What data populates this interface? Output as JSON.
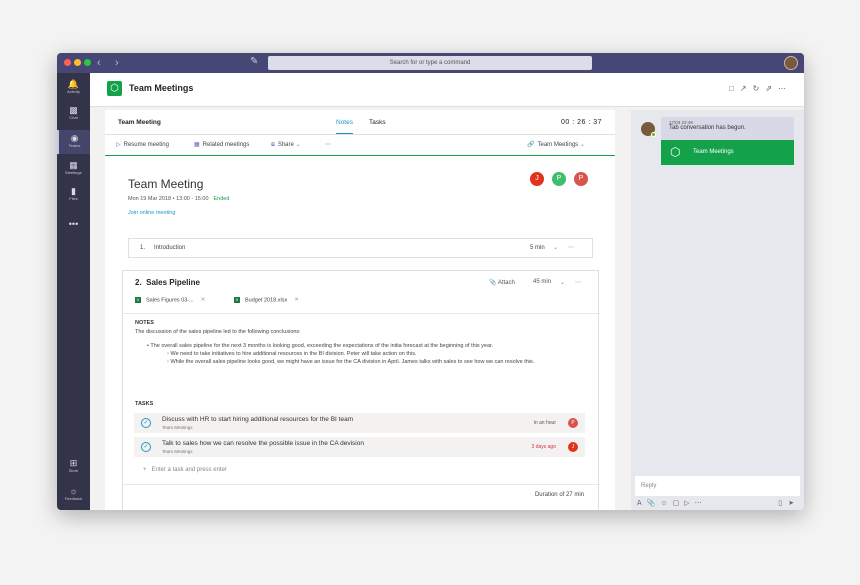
{
  "window": {
    "search_placeholder": "Search for or type a command",
    "colors": {
      "titlebar": "#464775",
      "rail": "#33344a",
      "accent_green": "#13a24a",
      "link_blue": "#2196c4"
    }
  },
  "rail": {
    "items": [
      {
        "label": "Activity",
        "icon": "bell-icon"
      },
      {
        "label": "Chat",
        "icon": "chat-icon"
      },
      {
        "label": "Teams",
        "icon": "teams-icon"
      },
      {
        "label": "Meetings",
        "icon": "calendar-icon"
      },
      {
        "label": "Files",
        "icon": "file-icon"
      },
      {
        "label": "•••",
        "icon": "more-icon"
      }
    ],
    "bottom": [
      {
        "label": "Store",
        "icon": "store-icon"
      },
      {
        "label": "Feedback",
        "icon": "feedback-icon"
      }
    ]
  },
  "app": {
    "title": "Team Meetings"
  },
  "meeting": {
    "header_title": "Team Meeting",
    "tabs": [
      "Notes",
      "Tasks"
    ],
    "timer": "00 : 26 : 37",
    "toolbar": {
      "resume": "Resume meeting",
      "related": "Related meetings",
      "share": "Share",
      "team": "Team Meetings"
    },
    "title": "Team Meeting",
    "date": "Mon 19 Mar 2018 • 13:00 - 15:00",
    "status": "Ended",
    "join": "Join online meeting",
    "attendees": [
      {
        "initial": "J",
        "color": "#e2331d"
      },
      {
        "initial": "P",
        "color": "#3fbf6e"
      },
      {
        "initial": "P",
        "color": "#d9534f"
      }
    ],
    "agenda1": {
      "num": "1.",
      "title": "Introduction",
      "duration": "5 min"
    },
    "agenda2": {
      "num": "2.",
      "title": "Sales Pipeline",
      "attach": "Attach",
      "duration": "45 min",
      "files": [
        "Sales Figures 03-...",
        "Budget 2018.xlsx"
      ],
      "notes_label": "NOTES",
      "notes_intro": "The discussion of the sales pipeline led to the following conclusions:",
      "bullets": [
        "The overall sales pipeline for the next 3 months is looking good, exceeding the expectations of the initia forecast at the beginning of this year.",
        "We need to take initiatives to hire additional resources in the BI division. Peter will take action on this.",
        "While the overall sales pipeline looks good, we might have an issue for the CA division in April. James talks with sales to see how we can resolve this."
      ],
      "tasks_label": "TASKS",
      "tasks": [
        {
          "title": "Discuss with HR to start hiring additional resources for the BI team",
          "sub": "Team Meetings",
          "due": "in an hour",
          "assignee": "P",
          "color": "#d9534f",
          "due_color": "#555555"
        },
        {
          "title": "Talk to sales how we can resolve the possible issue in the CA devision",
          "sub": "Team Meetings",
          "due": "3 days ago",
          "assignee": "J",
          "color": "#e2331d",
          "due_color": "#d13438"
        }
      ],
      "add_task": "Enter a task and press enter",
      "total": "Duration of 27 min"
    }
  },
  "chat": {
    "time": "17/03 22:49",
    "message": "Tab conversation has begun.",
    "card_title": "Team Meetings",
    "reply_placeholder": "Reply"
  }
}
